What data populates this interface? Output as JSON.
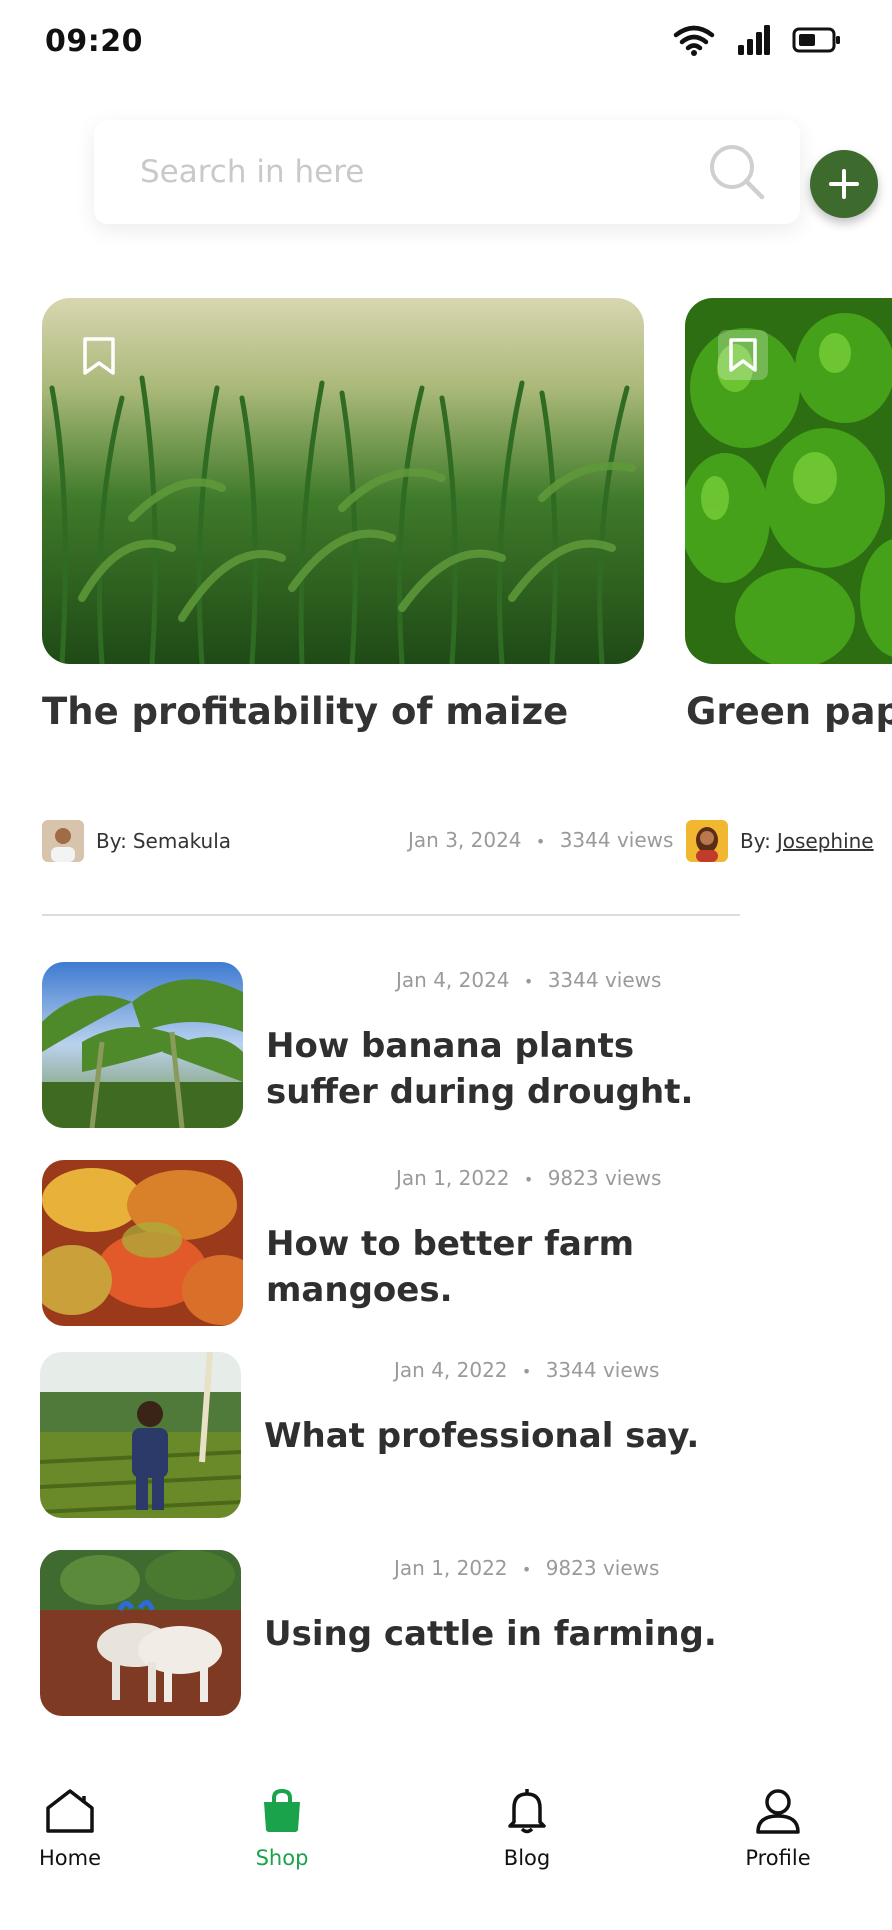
{
  "status": {
    "time": "09:20"
  },
  "search": {
    "placeholder": "Search in here"
  },
  "featured": [
    {
      "title": "The profitability of maize",
      "author_prefix": "By:",
      "author": "Semakula",
      "date": "Jan 3, 2024",
      "views": "3344 views"
    },
    {
      "title": "Green pape",
      "author_prefix": "By:",
      "author": "Josephine"
    }
  ],
  "articles": [
    {
      "date": "Jan 4, 2024",
      "views": "3344 views",
      "title": "How banana plants suffer during drought."
    },
    {
      "date": "Jan 1, 2022",
      "views": "9823 views",
      "title": "How to better farm mangoes."
    },
    {
      "date": "Jan 4, 2022",
      "views": "3344 views",
      "title": "What professional say."
    },
    {
      "date": "Jan 1, 2022",
      "views": "9823 views",
      "title": "Using cattle in farming."
    }
  ],
  "nav": {
    "items": [
      {
        "label": "Home",
        "icon": "home-icon"
      },
      {
        "label": "Shop",
        "icon": "shopping-bag-icon"
      },
      {
        "label": "Blog",
        "icon": "bell-icon"
      },
      {
        "label": "Profile",
        "icon": "profile-icon"
      }
    ],
    "active": "Shop"
  },
  "colors": {
    "accent_green": "#1aa34a",
    "fab_green": "#3d6b2d"
  },
  "bullet": "•"
}
